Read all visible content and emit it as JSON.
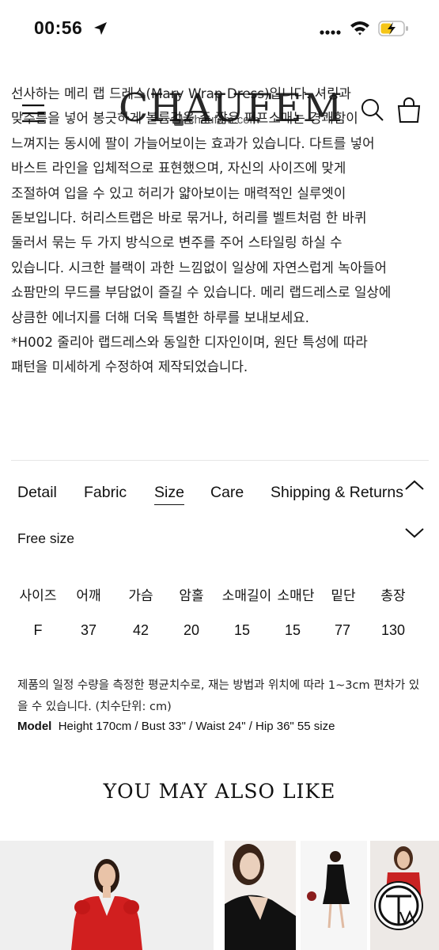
{
  "status_bar": {
    "time": "00:56"
  },
  "browser": {
    "url": "chaufem.com"
  },
  "header": {
    "brand": "CHAUFEM"
  },
  "description": {
    "lines": [
      "선사하는 메리 랩 드레스(Mary Wrap Dress)입니다. 셔링과",
      "맞주름을 넣어 봉긋하게 볼륨감을 준 짧은 퍼프소매는 경쾌함이",
      "느껴지는 동시에 팔이 가늘어보이는 효과가 있습니다. 다트를 넣어",
      "바스트 라인을 입체적으로 표현했으며, 자신의 사이즈에 맞게",
      "조절하여 입을 수 있고 허리가 얇아보이는 매력적인 실루엣이",
      "돋보입니다. 허리스트랩은 바로 묶거나, 허리를 벨트처럼 한 바퀴",
      "둘러서 묶는 두 가지 방식으로 변주를 주어 스타일링 하실 수",
      "있습니다. 시크한 블랙이 과한 느낌없이 일상에 자연스럽게 녹아들어",
      "쇼팜만의 무드를 부담없이 즐길 수 있습니다. 메리 랩드레스로 일상에",
      "상큼한 에너지를 더해 더욱 특별한 하루를 보내보세요.",
      "*H002 줄리아 랩드레스와 동일한 디자인이며, 원단 특성에 따라",
      "패턴을 미세하게 수정하여 제작되었습니다."
    ]
  },
  "tabs": [
    "Detail",
    "Fabric",
    "Size",
    "Care",
    "Shipping & Returns"
  ],
  "active_tab": "Size",
  "size_info": {
    "label": "Free size",
    "headers": [
      "사이즈",
      "어깨",
      "가슴",
      "암홀",
      "소매길이",
      "소매단",
      "밑단",
      "총장"
    ],
    "row": [
      "F",
      "37",
      "42",
      "20",
      "15",
      "15",
      "77",
      "130"
    ]
  },
  "note": {
    "text": "제품의 일정 수량을 측정한 평균치수로, 재는 방법과 위치에 따라 1~3cm 편차가 있을 수 있습니다. (치수단위: cm)",
    "model_label": "Model",
    "model_text": "Height 170cm / Bust 33\" / Waist 24\" / Hip 36\" 55 size"
  },
  "recommend": {
    "title": "YOU MAY ALSO LIKE"
  },
  "colors": {
    "text": "#111111",
    "divider": "#e6e6e6",
    "battery": "#f5c518",
    "dress_red": "#d11f1f"
  }
}
